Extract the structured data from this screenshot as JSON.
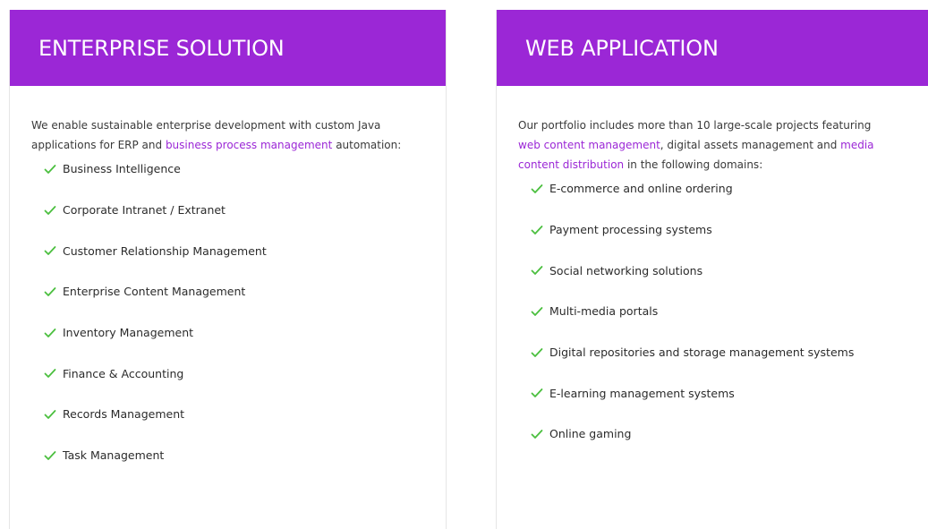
{
  "colors": {
    "header_bg": "#9b27d6",
    "link": "#9b27d6",
    "check": "#4bbf3f"
  },
  "icons": {
    "list_bullet": "check-icon"
  },
  "left": {
    "title": "ENTERPRISE SOLUTION",
    "intro_text_1": "We enable sustainable enterprise development with custom Java applications for ERP and ",
    "intro_link_1": "business process management",
    "intro_text_2": " automation:",
    "items": [
      "Business Intelligence",
      "Corporate Intranet / Extranet",
      "Customer Relationship Management",
      "Enterprise Content Management",
      "Inventory Management",
      "Finance & Accounting",
      "Records Management",
      "Task Management"
    ]
  },
  "right": {
    "title": "WEB APPLICATION",
    "intro_text_1": "Our portfolio includes more than 10 large-scale projects featuring ",
    "intro_link_1": "web content management",
    "intro_text_2": ", digital assets management and ",
    "intro_link_2": "media content distribution",
    "intro_text_3": " in the following domains:",
    "items": [
      "E-commerce and online ordering",
      "Payment processing systems",
      "Social networking solutions",
      "Multi-media portals",
      "Digital repositories and storage management systems",
      "E-learning management systems",
      "Online gaming"
    ]
  }
}
